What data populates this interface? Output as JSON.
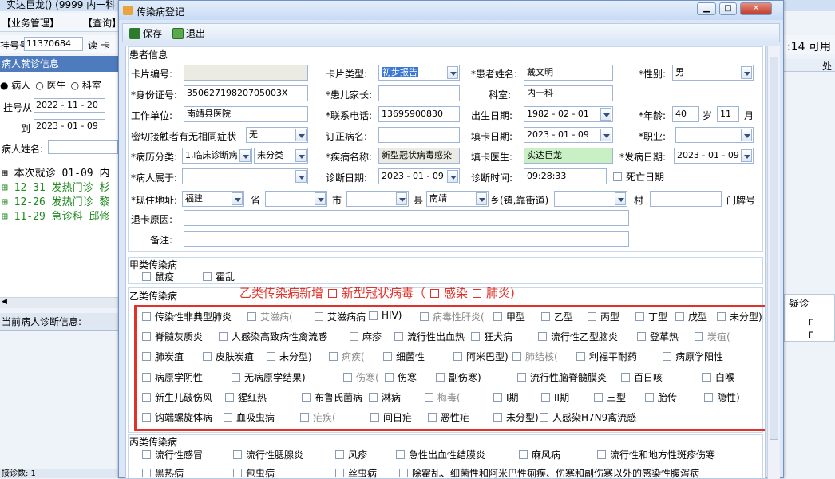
{
  "background": {
    "title": "实达巨龙() (9999 内一科",
    "menu": [
      "【业务管理】",
      "【查询】"
    ],
    "reg_no_label": "挂号号",
    "reg_no_value": "11370684",
    "read_card_label": "读 卡",
    "panel_title": "病人就诊信息",
    "radios": [
      "病人",
      "医生",
      "科室"
    ],
    "date_from_label": "挂号从",
    "date_from": "2022 - 11 - 20",
    "date_to_label": "到",
    "date_to": "2023 - 01 - 09",
    "patient_name_label": "病人姓名:",
    "visits": [
      {
        "text": "本次就诊 01-09 内",
        "color": "#000000"
      },
      {
        "text": "12-31 发热门诊 杉",
        "color": "#1f8a1f"
      },
      {
        "text": "12-26 发热门诊 黎",
        "color": "#1f8a1f"
      },
      {
        "text": "11-29 急诊科 邱修",
        "color": "#1f8a1f"
      }
    ],
    "diag_panel_title": "当前病人诊断信息:",
    "bottom_status": "接诊数: 1",
    "right_top_text": ":14 可用",
    "right_col_header": "处",
    "right_grid_header": "疑诊"
  },
  "dialog": {
    "title": "传染病登记",
    "save_label": "保存",
    "exit_label": "退出",
    "patient_info_title": "患者信息",
    "fields": {
      "card_no_label": "卡片编号:",
      "card_type_label": "卡片类型:",
      "card_type_value": "初步报告",
      "patient_name_label": "*患者姓名:",
      "patient_name_value": "戴文明",
      "gender_label": "*性别:",
      "gender_value": "男",
      "id_no_label": "*身份证号:",
      "id_no_value": "35062719820705003X",
      "guardian_label": "*患儿家长:",
      "dept_label": "科室:",
      "dept_value": "内一科",
      "workplace_label": "工作单位:",
      "workplace_value": "南靖县医院",
      "phone_label": "*联系电话:",
      "phone_value": "13695900830",
      "birth_label": "出生日期:",
      "birth_value": "1982 - 02 - 01",
      "age_label": "*年龄:",
      "age_value": "40",
      "age_unit_years": "岁",
      "age_months": "11",
      "age_unit_months": "月",
      "contact_label": "密切接触者有无相同症状",
      "contact_value": "无",
      "revised_label": "订正病名:",
      "fill_date_label": "填卡日期:",
      "fill_date_value": "2023 - 01 - 09",
      "occupation_label": "*职业:",
      "case_class_label": "*病历分类:",
      "case_class_value": "1,临床诊断病",
      "case_class_value2": "未分类",
      "disease_label": "*疾病名称:",
      "disease_value": "新型冠状病毒感染",
      "doctor_label": "填卡医生:",
      "doctor_value": "实达巨龙",
      "onset_label": "*发病日期:",
      "onset_value": "2023 - 01 - 09",
      "belong_label": "*病人属于:",
      "diag_date_label": "诊断日期:",
      "diag_date_value": "2023 - 01 - 09",
      "diag_time_label": "诊断时间:",
      "diag_time_value": "09:28:33",
      "death_label": "死亡日期",
      "address_label": "*现住地址:",
      "province_value": "福建",
      "province_label": "省",
      "city_label": "市",
      "county_label": "县",
      "county_value": "南靖",
      "town_label": "乡(镇,靠街道)",
      "village_label": "村",
      "house_label": "门牌号",
      "return_reason_label": "退卡原因:",
      "remark_label": "备注:"
    },
    "class_a_title": "甲类传染病",
    "class_a": [
      "鼠疫",
      "霍乱"
    ],
    "class_b_title": "乙类传染病",
    "annotation": {
      "prefix": "乙类传染病新增",
      "covid": "新型冠状病毒（",
      "infection": "感染",
      "pneumonia": "肺炎)"
    },
    "class_b_rows": [
      [
        "传染性非典型肺炎",
        "艾滋病(",
        "艾滋病病",
        "HIV)",
        "病毒性肝炎(",
        "甲型",
        "乙型",
        "丙型",
        "丁型",
        "戊型",
        "未分型)"
      ],
      [
        "脊髓灰质炎",
        "人感染高致病性禽流感",
        "麻疹",
        "流行性出血热",
        "狂犬病",
        "流行性乙型脑炎",
        "登革热",
        "炭疽("
      ],
      [
        "肺炭疽",
        "皮肤炭疽",
        "未分型)",
        "痢疾(",
        "细菌性",
        "阿米巴型)",
        "肺结核(",
        "利福平耐药",
        "病原学阳性"
      ],
      [
        "病原学阴性",
        "无病原学结果)",
        "伤寒(",
        "伤寒",
        "副伤寒)",
        "流行性脑脊髓膜炎",
        "百日咳",
        "白喉"
      ],
      [
        "新生儿破伤风",
        "猩红热",
        "布鲁氏菌病",
        "淋病",
        "梅毒(",
        "I期",
        "II期",
        "三型",
        "胎传",
        "隐性)"
      ],
      [
        "钩端螺旋体病",
        "血吸虫病",
        "疟疾(",
        "间日疟",
        "恶性疟",
        "未分型)",
        "人感染H7N9禽流感"
      ]
    ],
    "class_c_title": "丙类传染病",
    "class_c_rows": [
      [
        "流行性感冒",
        "流行性腮腺炎",
        "风疹",
        "急性出血性结膜炎",
        "麻风病",
        "流行性和地方性斑疹伤寒"
      ],
      [
        "黑热病",
        "包虫病",
        "丝虫病",
        "除霍乱、细菌性和阿米巴性痢疾、伤寒和副伤寒以外的感染性腹泻病"
      ]
    ]
  }
}
